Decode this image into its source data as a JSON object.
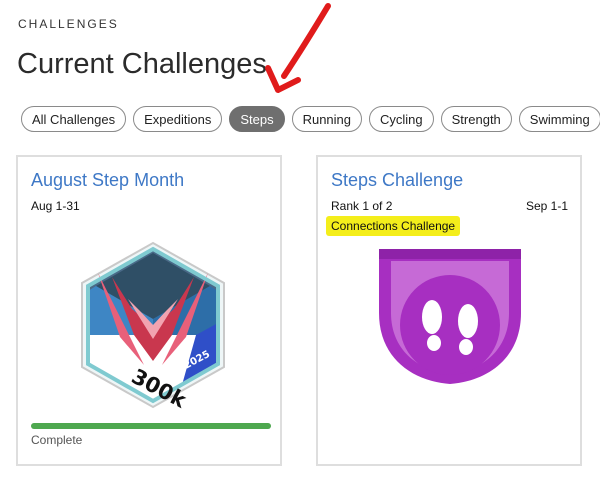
{
  "header": {
    "eyebrow": "CHALLENGES",
    "title": "Current Challenges"
  },
  "filters": [
    {
      "label": "All Challenges",
      "active": false
    },
    {
      "label": "Expeditions",
      "active": false
    },
    {
      "label": "Steps",
      "active": true
    },
    {
      "label": "Running",
      "active": false
    },
    {
      "label": "Cycling",
      "active": false
    },
    {
      "label": "Strength",
      "active": false
    },
    {
      "label": "Swimming",
      "active": false
    }
  ],
  "cards": [
    {
      "title": "August Step Month",
      "dates": "Aug 1-31",
      "badge": {
        "icon": "300k-steps-hexagon-badge-icon",
        "number": "300k",
        "year": "2025"
      },
      "progress": 1.0,
      "status": "Complete"
    },
    {
      "title": "Steps Challenge",
      "rank": "Rank 1 of 2",
      "dates": "Sep 1-1",
      "subtitle": "Connections Challenge",
      "badge": {
        "icon": "footprints-shield-badge-icon"
      }
    }
  ],
  "annotations": {
    "arrow_color": "#e01b1b",
    "highlight_color": "#f4ee1b"
  },
  "colors": {
    "accent_link": "#3e78c6",
    "active_pill": "#6f6f6f",
    "progress": "#4ea84f",
    "shield_purple": "#a72fc1"
  }
}
